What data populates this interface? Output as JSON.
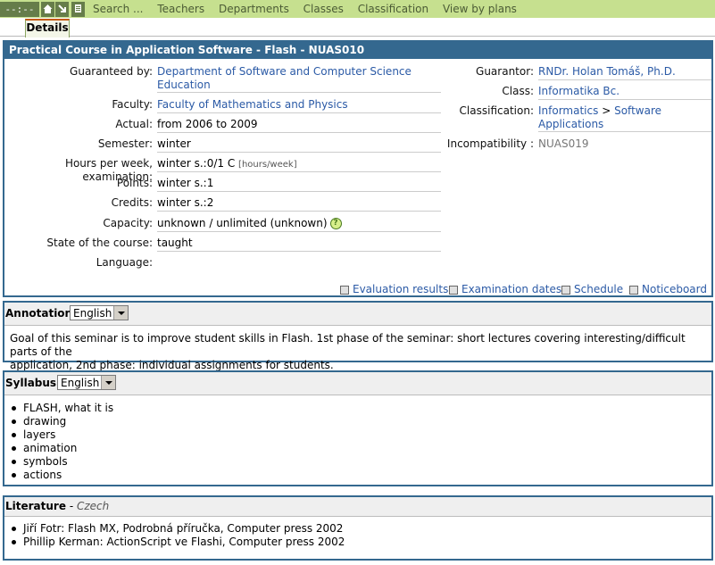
{
  "topbar": {
    "clock": "--:--",
    "menu": [
      "Search ...",
      "Teachers",
      "Departments",
      "Classes",
      "Classification",
      "View by plans"
    ]
  },
  "tabs": [
    "Details"
  ],
  "course": {
    "title": "Practical Course in Application Software - Flash - NUAS010",
    "left_fields": [
      {
        "label": "Guaranteed by:",
        "value": "Department of Software and Computer Science Education",
        "link": true
      },
      {
        "label": "Faculty:",
        "value": "Faculty of Mathematics and Physics",
        "link": true
      },
      {
        "label": "Actual:",
        "value": "from 2006 to 2009"
      },
      {
        "label": "Semester:",
        "value": "winter"
      },
      {
        "label": "Hours per week, examination:",
        "value": "winter s.:0/1 C",
        "note": "[hours/week]"
      },
      {
        "label": "Points:",
        "value": "winter s.:1"
      },
      {
        "label": "Credits:",
        "value": "winter s.:2"
      },
      {
        "label": "Capacity:",
        "value": "unknown / unlimited (unknown)",
        "help": "?"
      },
      {
        "label": "State of the course:",
        "value": "taught"
      },
      {
        "label": "Language:",
        "value": ""
      }
    ],
    "right_fields": {
      "guarantor_label": "Guarantor:",
      "guarantor": "RNDr. Holan Tomáš, Ph.D.",
      "class_label": "Class:",
      "class": "Informatika Bc.",
      "classification_label": "Classification:",
      "classification_1": "Informatics",
      "classification_sep": ">",
      "classification_2": "Software",
      "classification_3": "Applications",
      "incompat_label": "Incompatibility :",
      "incompat": "NUAS019"
    },
    "actions": [
      "Evaluation results",
      "Examination dates",
      "Schedule",
      "Noticeboard"
    ]
  },
  "annotation": {
    "heading": "Annotation",
    "sep": " - ",
    "language": "English",
    "text_line1": "Goal of this seminar is to improve student skills in Flash. 1st phase of the seminar: short lectures covering interesting/difficult parts of the",
    "text_line2": "application, 2nd phase: individual assignments for students."
  },
  "syllabus": {
    "heading": "Syllabus",
    "sep": " - ",
    "language": "English",
    "items": [
      "FLASH, what it is",
      "drawing",
      "layers",
      "animation",
      "symbols",
      "actions"
    ]
  },
  "literature": {
    "heading": "Literature",
    "sep": " - ",
    "language": "Czech",
    "items": [
      "Jiří Fotr: Flash MX, Podrobná příručka, Computer press 2002",
      "Phillip Kerman: ActionScript ve Flashi, Computer press 2002"
    ]
  },
  "colors": {
    "panel_border": "#34688f",
    "topbar": "#c6e08f",
    "link": "#2b5aa6"
  }
}
